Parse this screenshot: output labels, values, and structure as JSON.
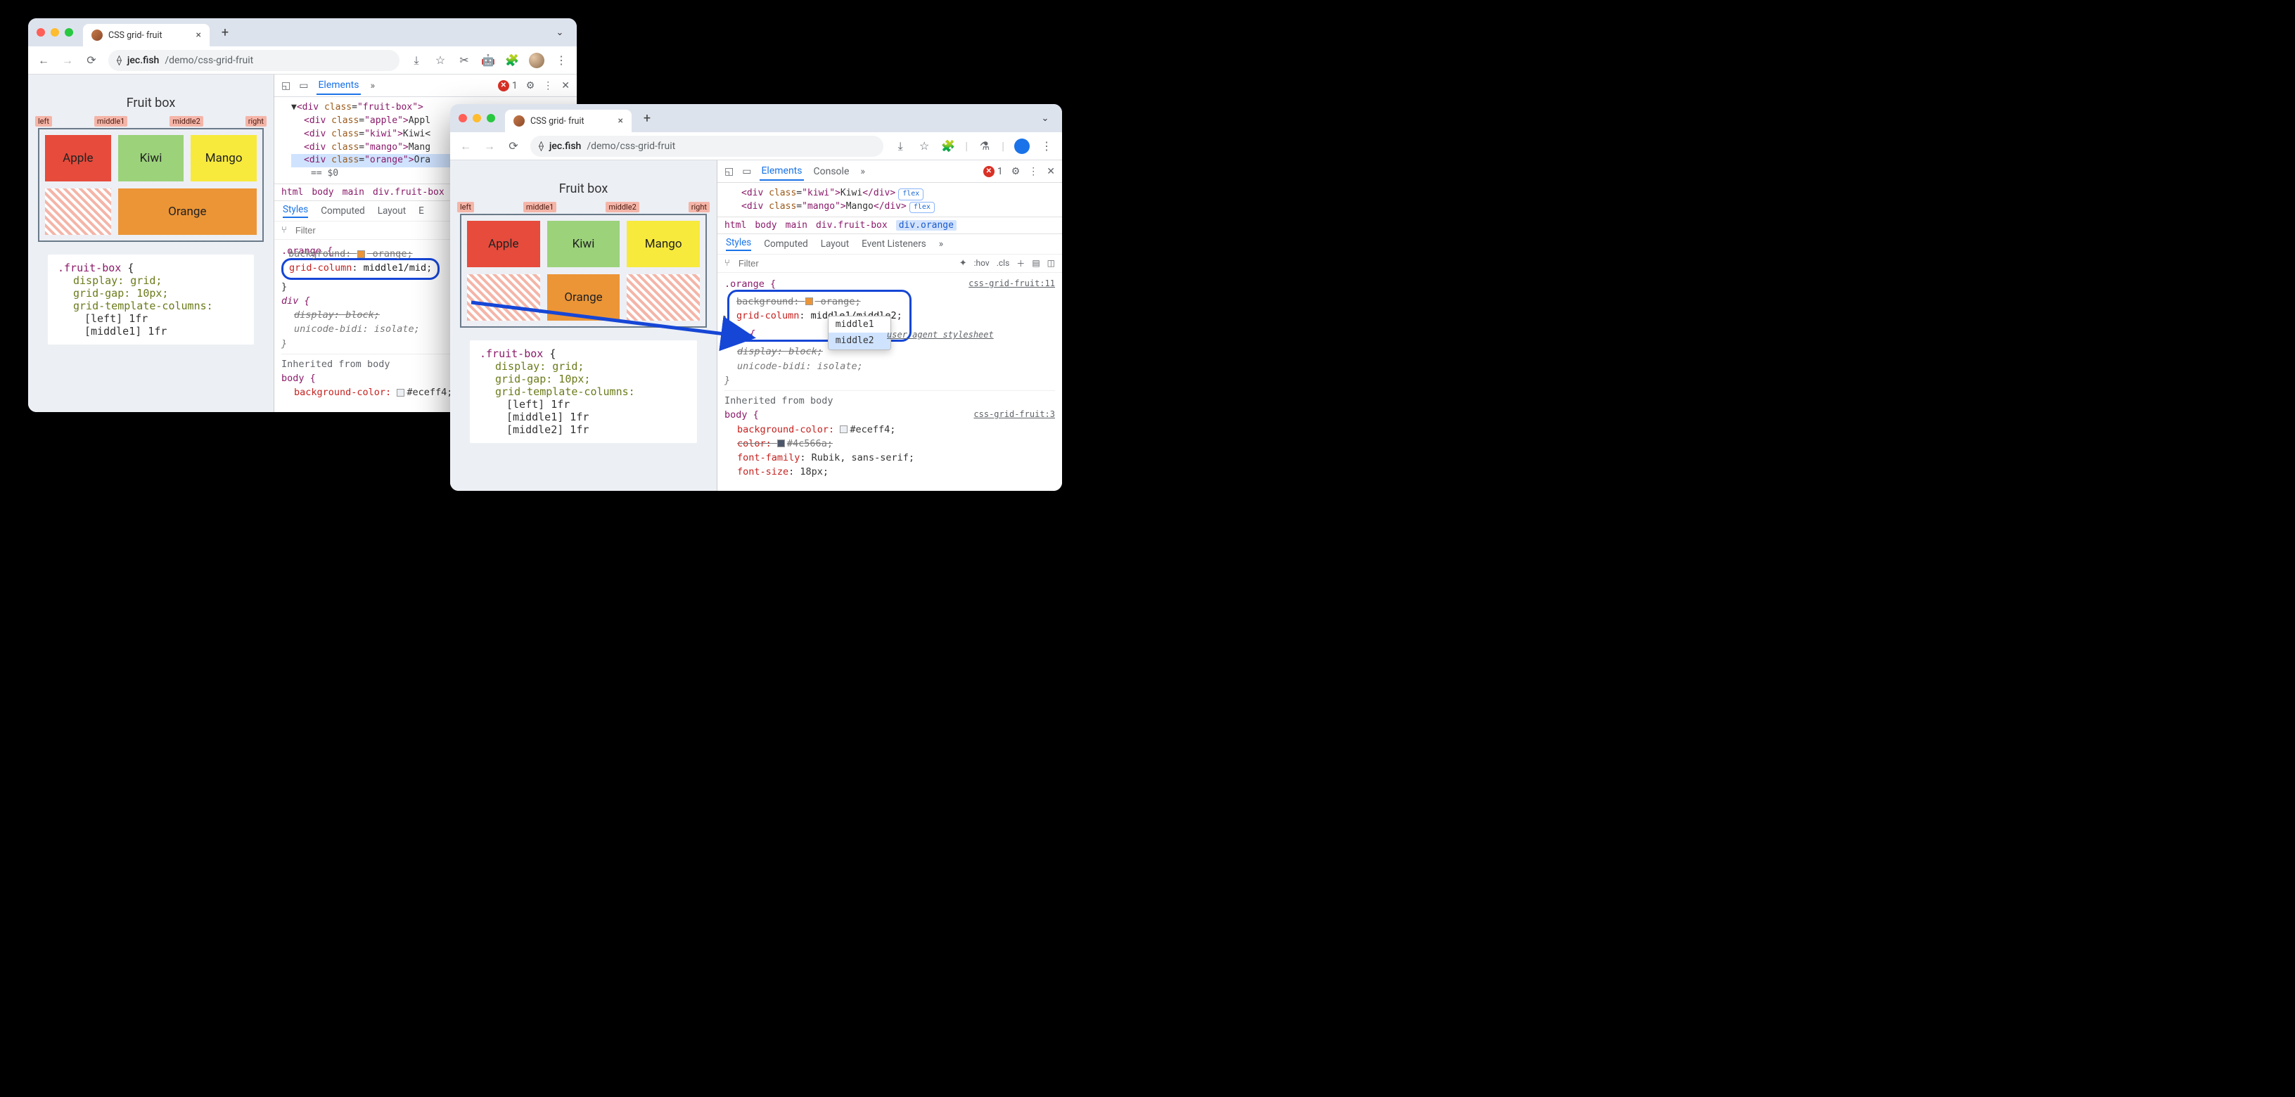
{
  "browser": {
    "tabTitle": "CSS grid- fruit",
    "url": {
      "domain": "jec.fish",
      "path": "/demo/css-grid-fruit"
    }
  },
  "page": {
    "title": "Fruit box",
    "lineNames": [
      "left",
      "middle1",
      "middle2",
      "right"
    ],
    "cells": {
      "apple": "Apple",
      "kiwi": "Kiwi",
      "mango": "Mango",
      "orange": "Orange"
    },
    "cssSelector": ".fruit-box",
    "cssDecls": [
      "display: grid;",
      "grid-gap: 10px;",
      "grid-template-columns:",
      "[left] 1fr",
      "[middle1] 1fr",
      "[middle2] 1fr"
    ]
  },
  "devtools": {
    "tabs": {
      "elements": "Elements",
      "console": "Console",
      "more": "»"
    },
    "errorCount": "1",
    "dom": {
      "fruitBox": "<div class=\"fruit-box\">",
      "apple": "<div class=\"apple\">Apple</div>",
      "kiwi": "<div class=\"kiwi\">Kiwi</div>",
      "mango": "<div class=\"mango\">Mango</div>",
      "orange": "<div class=\"orange\">Orange</div>",
      "dollars": "== $0",
      "flex": "flex"
    },
    "crumbs": [
      "html",
      "body",
      "main",
      "div.fruit-box",
      "div.orange"
    ],
    "styleTabs": {
      "styles": "Styles",
      "computed": "Computed",
      "layout": "Layout",
      "events": "Event Listeners",
      "more": "»"
    },
    "filter": {
      "placeholder": "Filter",
      "hov": ":hov",
      "cls": ".cls"
    },
    "orangeRule": {
      "selector": ".orange {",
      "bgDecl": "background: ▮ orange;",
      "gcProp": "grid-column",
      "gcValLeft": "middle1/mid",
      "gcValRight": "middle1/middle2",
      "close": "}"
    },
    "divUA": {
      "selector": "div {",
      "display": "display: block;",
      "bidi": "unicode-bidi: isolate;",
      "src": "user agent stylesheet"
    },
    "inheritFrom": "Inherited from",
    "inheritBody": "body",
    "bodyRule": {
      "selector": "body {",
      "bg": "background-color:",
      "bgVal": "#eceff4;",
      "color": "color:",
      "colorVal": "#4c566a;",
      "ff": "font-family: Rubik, sans-serif;",
      "fs": "font-size: 18px;",
      "srcLeft": "css-grid-fruit:11",
      "srcRight": "css-grid-fruit:3"
    },
    "autocomplete": [
      "middle1",
      "middle2"
    ]
  }
}
